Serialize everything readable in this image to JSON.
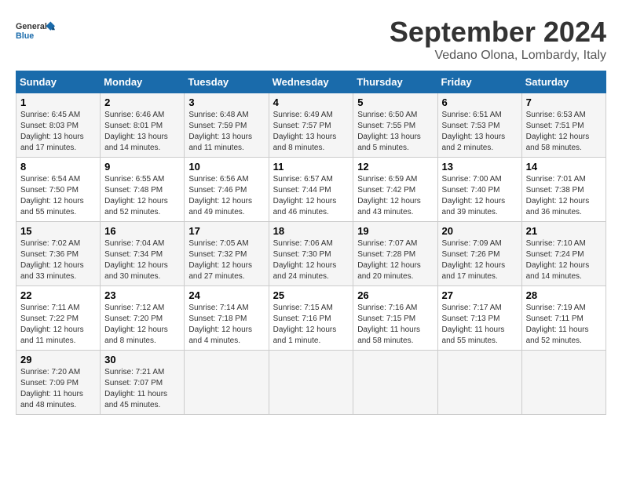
{
  "logo": {
    "line1": "General",
    "line2": "Blue"
  },
  "title": "September 2024",
  "subtitle": "Vedano Olona, Lombardy, Italy",
  "days_header": [
    "Sunday",
    "Monday",
    "Tuesday",
    "Wednesday",
    "Thursday",
    "Friday",
    "Saturday"
  ],
  "weeks": [
    [
      {
        "day": "1",
        "info": "Sunrise: 6:45 AM\nSunset: 8:03 PM\nDaylight: 13 hours\nand 17 minutes."
      },
      {
        "day": "2",
        "info": "Sunrise: 6:46 AM\nSunset: 8:01 PM\nDaylight: 13 hours\nand 14 minutes."
      },
      {
        "day": "3",
        "info": "Sunrise: 6:48 AM\nSunset: 7:59 PM\nDaylight: 13 hours\nand 11 minutes."
      },
      {
        "day": "4",
        "info": "Sunrise: 6:49 AM\nSunset: 7:57 PM\nDaylight: 13 hours\nand 8 minutes."
      },
      {
        "day": "5",
        "info": "Sunrise: 6:50 AM\nSunset: 7:55 PM\nDaylight: 13 hours\nand 5 minutes."
      },
      {
        "day": "6",
        "info": "Sunrise: 6:51 AM\nSunset: 7:53 PM\nDaylight: 13 hours\nand 2 minutes."
      },
      {
        "day": "7",
        "info": "Sunrise: 6:53 AM\nSunset: 7:51 PM\nDaylight: 12 hours\nand 58 minutes."
      }
    ],
    [
      {
        "day": "8",
        "info": "Sunrise: 6:54 AM\nSunset: 7:50 PM\nDaylight: 12 hours\nand 55 minutes."
      },
      {
        "day": "9",
        "info": "Sunrise: 6:55 AM\nSunset: 7:48 PM\nDaylight: 12 hours\nand 52 minutes."
      },
      {
        "day": "10",
        "info": "Sunrise: 6:56 AM\nSunset: 7:46 PM\nDaylight: 12 hours\nand 49 minutes."
      },
      {
        "day": "11",
        "info": "Sunrise: 6:57 AM\nSunset: 7:44 PM\nDaylight: 12 hours\nand 46 minutes."
      },
      {
        "day": "12",
        "info": "Sunrise: 6:59 AM\nSunset: 7:42 PM\nDaylight: 12 hours\nand 43 minutes."
      },
      {
        "day": "13",
        "info": "Sunrise: 7:00 AM\nSunset: 7:40 PM\nDaylight: 12 hours\nand 39 minutes."
      },
      {
        "day": "14",
        "info": "Sunrise: 7:01 AM\nSunset: 7:38 PM\nDaylight: 12 hours\nand 36 minutes."
      }
    ],
    [
      {
        "day": "15",
        "info": "Sunrise: 7:02 AM\nSunset: 7:36 PM\nDaylight: 12 hours\nand 33 minutes."
      },
      {
        "day": "16",
        "info": "Sunrise: 7:04 AM\nSunset: 7:34 PM\nDaylight: 12 hours\nand 30 minutes."
      },
      {
        "day": "17",
        "info": "Sunrise: 7:05 AM\nSunset: 7:32 PM\nDaylight: 12 hours\nand 27 minutes."
      },
      {
        "day": "18",
        "info": "Sunrise: 7:06 AM\nSunset: 7:30 PM\nDaylight: 12 hours\nand 24 minutes."
      },
      {
        "day": "19",
        "info": "Sunrise: 7:07 AM\nSunset: 7:28 PM\nDaylight: 12 hours\nand 20 minutes."
      },
      {
        "day": "20",
        "info": "Sunrise: 7:09 AM\nSunset: 7:26 PM\nDaylight: 12 hours\nand 17 minutes."
      },
      {
        "day": "21",
        "info": "Sunrise: 7:10 AM\nSunset: 7:24 PM\nDaylight: 12 hours\nand 14 minutes."
      }
    ],
    [
      {
        "day": "22",
        "info": "Sunrise: 7:11 AM\nSunset: 7:22 PM\nDaylight: 12 hours\nand 11 minutes."
      },
      {
        "day": "23",
        "info": "Sunrise: 7:12 AM\nSunset: 7:20 PM\nDaylight: 12 hours\nand 8 minutes."
      },
      {
        "day": "24",
        "info": "Sunrise: 7:14 AM\nSunset: 7:18 PM\nDaylight: 12 hours\nand 4 minutes."
      },
      {
        "day": "25",
        "info": "Sunrise: 7:15 AM\nSunset: 7:16 PM\nDaylight: 12 hours\nand 1 minute."
      },
      {
        "day": "26",
        "info": "Sunrise: 7:16 AM\nSunset: 7:15 PM\nDaylight: 11 hours\nand 58 minutes."
      },
      {
        "day": "27",
        "info": "Sunrise: 7:17 AM\nSunset: 7:13 PM\nDaylight: 11 hours\nand 55 minutes."
      },
      {
        "day": "28",
        "info": "Sunrise: 7:19 AM\nSunset: 7:11 PM\nDaylight: 11 hours\nand 52 minutes."
      }
    ],
    [
      {
        "day": "29",
        "info": "Sunrise: 7:20 AM\nSunset: 7:09 PM\nDaylight: 11 hours\nand 48 minutes."
      },
      {
        "day": "30",
        "info": "Sunrise: 7:21 AM\nSunset: 7:07 PM\nDaylight: 11 hours\nand 45 minutes."
      },
      {
        "day": "",
        "info": ""
      },
      {
        "day": "",
        "info": ""
      },
      {
        "day": "",
        "info": ""
      },
      {
        "day": "",
        "info": ""
      },
      {
        "day": "",
        "info": ""
      }
    ]
  ]
}
